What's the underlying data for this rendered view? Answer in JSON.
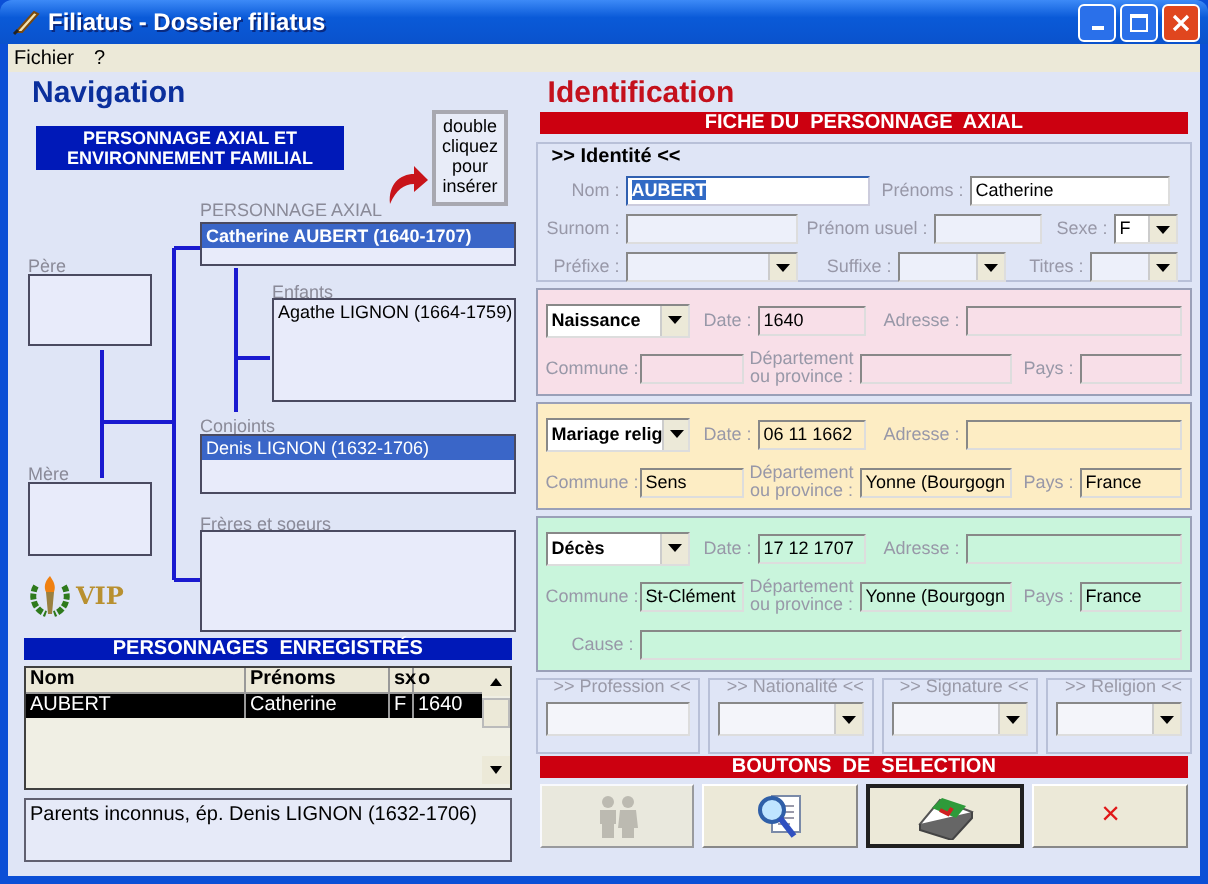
{
  "window": {
    "title": "Filiatus - Dossier filiatus"
  },
  "menu": [
    "Fichier",
    "?"
  ],
  "navigation": {
    "title": "Navigation",
    "banner": "PERSONNAGE AXIAL ET ENVIRONNEMENT FAMILIAL",
    "photo_hint": "double cliquez pour insérer",
    "tree": {
      "axial": {
        "label": "PERSONNAGE AXIAL",
        "items": [
          {
            "text": "Catherine AUBERT (1640-1707)",
            "selected": true
          }
        ]
      },
      "father": {
        "label": "Père"
      },
      "children": {
        "label": "Enfants",
        "items": [
          {
            "text": "Agathe LIGNON (1664-1759)",
            "selected": false
          }
        ]
      },
      "spouses": {
        "label": "Conjoints",
        "items": [
          {
            "text": "Denis LIGNON (1632-1706)",
            "selected": true
          }
        ]
      },
      "mother": {
        "label": "Mère"
      },
      "siblings": {
        "label": "Frères et soeurs"
      },
      "vip": "VIP"
    },
    "registered": {
      "title": "PERSONNAGES  ENREGISTRÉS",
      "columns": [
        "Nom",
        "Prénoms",
        "sx",
        "o"
      ],
      "rows": [
        {
          "cells": [
            "AUBERT",
            "Catherine",
            "F",
            "1640"
          ],
          "selected": true
        }
      ]
    },
    "summary": "Parents inconnus, ép. Denis LIGNON (1632-1706)"
  },
  "identification": {
    "title": "Identification",
    "banner": "FICHE DU  PERSONNAGE  AXIAL",
    "identity": {
      "legend": ">> Identité <<",
      "rows": [
        [
          {
            "label": "Nom :",
            "kind": "text",
            "value": "AUBERT",
            "highlighted": true
          },
          {
            "label": "Prénoms :",
            "kind": "text",
            "value": "Catherine",
            "highlighted": false
          }
        ],
        [
          {
            "label": "Surnom :",
            "kind": "text"
          },
          {
            "label": "Prénom usuel :",
            "kind": "text"
          },
          {
            "label": "Sexe :",
            "kind": "combo",
            "value": "F"
          }
        ],
        [
          {
            "label": "Préfixe :",
            "kind": "combo"
          },
          {
            "label": "Suffixe :",
            "kind": "combo"
          },
          {
            "label": "Titres :",
            "kind": "combo"
          }
        ]
      ]
    },
    "events": [
      {
        "type": "Naissance",
        "color": "#f8dfe8",
        "date_label": "Date :",
        "date": "1640",
        "address_label": "Adresse :",
        "commune_label": "Commune :",
        "department_label": "Département ou province :",
        "country_label": "Pays :"
      },
      {
        "type": "Mariage relig",
        "color": "#fdedc4",
        "date_label": "Date :",
        "date": "06 11 1662",
        "address_label": "Adresse :",
        "commune_label": "Commune :",
        "commune": "Sens",
        "department_label": "Département ou province :",
        "department": "Yonne (Bourgogn",
        "country_label": "Pays :",
        "country": "France"
      },
      {
        "type": "Décès",
        "color": "#c9f5dc",
        "date_label": "Date :",
        "date": "17 12 1707",
        "address_label": "Adresse :",
        "commune_label": "Commune :",
        "commune": "St-Clément",
        "department_label": "Département ou province :",
        "department": "Yonne (Bourgogn",
        "country_label": "Pays :",
        "country": "France",
        "cause_label": "Cause :"
      }
    ],
    "extra_groups": [
      {
        "legend": ">> Profession <<",
        "kind": "text"
      },
      {
        "legend": ">> Nationalité <<",
        "kind": "combo"
      },
      {
        "legend": ">> Signature <<",
        "kind": "combo"
      },
      {
        "legend": ">> Religion <<",
        "kind": "combo"
      }
    ],
    "buttons_banner": "BOUTONS  DE  SELECTION",
    "buttons": [
      {
        "kind": "people",
        "disabled": true,
        "focused": false
      },
      {
        "kind": "search-document",
        "disabled": false,
        "focused": false
      },
      {
        "kind": "book",
        "disabled": false,
        "focused": true
      },
      {
        "kind": "cancel",
        "text": "×",
        "disabled": false,
        "focused": false
      }
    ]
  }
}
